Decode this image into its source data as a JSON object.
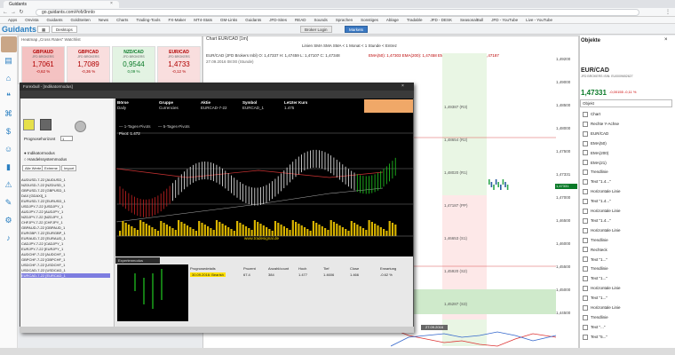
{
  "browser": {
    "tab_title": "Guidants",
    "url": "go.guidants.com/#ofz9nnlo",
    "bookmarks": [
      "Apps",
      "Onvista",
      "Guidants",
      "GoldSeiten",
      "News",
      "Charts",
      "Trading-Tools",
      "FX-Maker",
      "MT4-Stats",
      "GM-Links",
      "Guidants",
      "JFD-Sites",
      "READ",
      "Sounds",
      "Sprachen",
      "Sonstiges",
      "Ablage",
      "Tradable",
      "JFD - DESK",
      "SeasonalBull",
      "JFD - YouTube",
      "Live - YouTube"
    ]
  },
  "app": {
    "logo": "Guidants",
    "desktop_btn": "Desktops",
    "broker_btn": "Broker Login",
    "market_btn": "Markets"
  },
  "heatmap": {
    "title": "Heatmap „Cross Rates“ Watchlist",
    "tiles": [
      {
        "name": "GBP/AUD",
        "sub": "JFD BROKERS",
        "value": "1,7061",
        "pct": "-0,62 %",
        "color": "#f4c2c2",
        "text": "#b00000"
      },
      {
        "name": "GBP/CAD",
        "sub": "JFD BROKERS",
        "value": "1,7089",
        "pct": "-0,36 %",
        "color": "#f9dede",
        "text": "#b00000"
      },
      {
        "name": "NZD/CAD",
        "sub": "JFD BROKERS",
        "value": "0,9544",
        "pct": "0,09 %",
        "color": "#e3f3e3",
        "text": "#0a7a28"
      },
      {
        "name": "EUR/CAD",
        "sub": "JFD BROKERS",
        "value": "1,4733",
        "pct": "-0,12 %",
        "color": "#f9dede",
        "text": "#b00000"
      }
    ]
  },
  "main_chart": {
    "title": "Chart EUR/CAD [1m]",
    "toolbar": "Linien   SMA   SMA   SMA   < 1 Monat   < 1 Stunde   < Entrez",
    "info": "EUR/CAD (JFD Brokers Inbl)  O: 1,47337  H: 1,47459  L: 1,47107  C: 1,47348",
    "info_ema": "EMA(50): 1,47303    EMA(200): 1,47458    EMA(21): 1,47464    PP(D): 1,47187",
    "info2": "27.09.2016 08:00 (Stunde)",
    "price_ticks": [
      "1,49200",
      "1,49000",
      "1,48500",
      "1,48000",
      "1,47500",
      "1,47331",
      "1,47000",
      "1,46500",
      "1,46000",
      "1,45500",
      "1,45000",
      "1,44500"
    ],
    "pivots": [
      {
        "label": "1,49387 (R3)"
      },
      {
        "label": "1,48654 (R2)"
      },
      {
        "label": "1,48020 (R1)"
      },
      {
        "label": "1,47187 (PP)"
      },
      {
        "label": "1,46653 (S1)"
      },
      {
        "label": "1,45920 (S2)"
      },
      {
        "label": "1,45287 (S3)"
      }
    ],
    "date_label": "27.09.2016 16:00"
  },
  "right_panel": {
    "title": "Objekte",
    "symbol": "EUR/CAD",
    "symbol_sub": "JFD BROKERS  ISIN: EU0009652627",
    "price": "1,47331",
    "change": "-0,00155  -0,11 %",
    "input_placeholder": "Objekt",
    "items": [
      "Chart",
      "Rechte Y-Achse",
      "EUR/CAD",
      "EMA(50)",
      "EMA(200)",
      "EMA(21)",
      "Trendlinie",
      "Text \"1.4...\"",
      "Horizontale Linie",
      "Text \"1.4...\"",
      "Horizontale Linie",
      "Text \"1.4...\"",
      "Horizontale Linie",
      "Trendlinie",
      "Rechteck",
      "Text \"1...\"",
      "Trendlinie",
      "Text \"1...\"",
      "Horizontale Linie",
      "Text \"1...\"",
      "Horizontale Linie",
      "Trendlinie",
      "Text \"...\"",
      "Text \"5...\""
    ]
  },
  "tradesignal": {
    "window_title": "Forexbull - [Indikatormodus]",
    "left_panel": {
      "prognose_label": "Prognosehorizont",
      "prognose_value": "1",
      "radio1": "Indikatormodus",
      "radio2": "Handelssystemmodus",
      "tabs": [
        "Alle Werte",
        "Extreme",
        "Import"
      ],
      "list": [
        "AUDUSD-7-22 [AUDUSD_1",
        "NZDUSD-7-22 [NZDUSD_1",
        "GBPUSD-7-22 [GBPUSD_1",
        "DAX [GDAXI]_1",
        "EURUSD-7-22 [EURUSD_1",
        "USDJPY-7-22 [USDJPY_1",
        "AUDJPY-7-22 [AUDJPY_1",
        "NZDJPY-7-22 [NZDJPY_1",
        "CHFJPY-7-22 [CHFJPY_1",
        "GBPAUD-7-22 [GBPAUD_1",
        "EURGBP-7-22 [EURGBP_1",
        "EURAUD-7-22 [EURAUD_1",
        "CADJPY-7-22 [CADJPY_1",
        "EURJPY-7-22 [EURJPY_1",
        "AUDCHF-7-22 [AUDCHF_1",
        "GBPCHF-7-22 [GBPCHF_1",
        "USDCHF-7-22 [USDCHF_1",
        "USDCAD-7-22 [USDCAD_1",
        "EURCAD-7-22 [EURCAD_1"
      ]
    },
    "header_cols": [
      {
        "h": "Börse",
        "v": "Daily"
      },
      {
        "h": "Gruppe",
        "v": "Currencies"
      },
      {
        "h": "Aktie",
        "v": "EURCAD-7-22"
      },
      {
        "h": "Symbol",
        "v": "EURCAD_1"
      },
      {
        "h": "Letzter Kurs",
        "v": "1.475"
      },
      {
        "h": "Gesamtprognose",
        "v": "Bearish"
      }
    ],
    "legend": [
      "1-Tages-Pivots",
      "5-Tages-Pivots"
    ],
    "pivot_text": "Pivot: 1.472",
    "watermark": "www.tradesignal.de",
    "months": [
      "Juni",
      "Juli",
      "August",
      "September"
    ],
    "tab_label": "Expertenmodus",
    "table_headers": [
      "Prognosedetails",
      "Prozent",
      "Anzahl/count",
      "Hoch",
      "Tief",
      "Close",
      "Erwartung"
    ],
    "table_row": [
      "30.09.2016: Bearish",
      "67.4",
      "384",
      "1.477",
      "1.4606",
      "1.466",
      "-0.62 %"
    ]
  }
}
